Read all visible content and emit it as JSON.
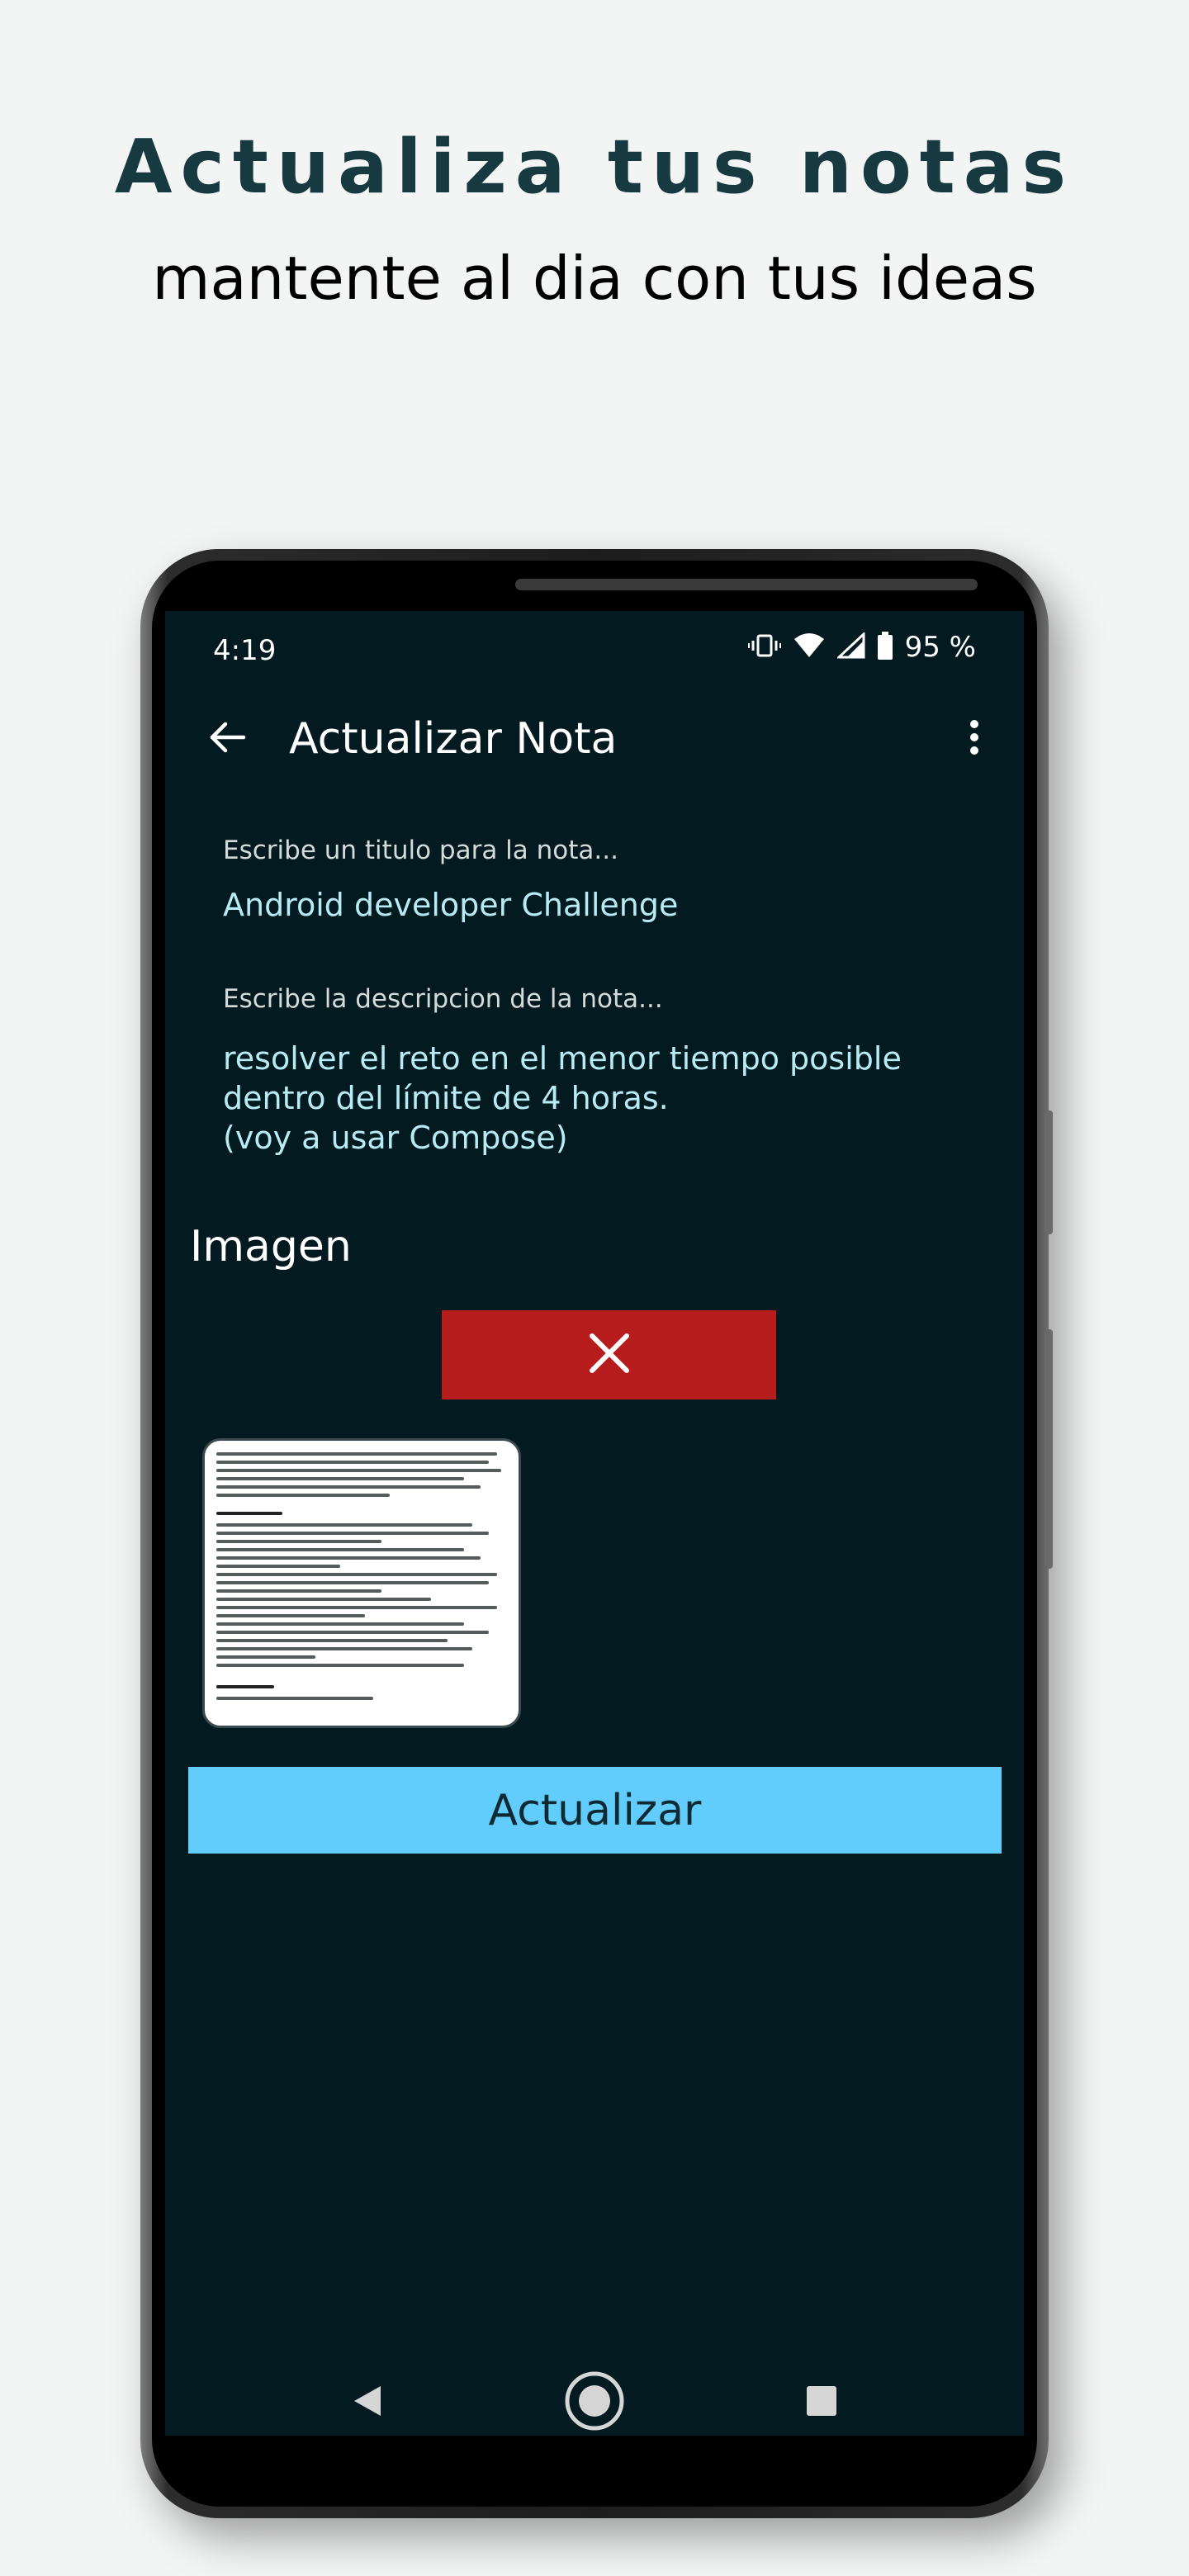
{
  "promo": {
    "headline": "Actualiza tus notas",
    "subheadline": "mantente al dia con tus ideas"
  },
  "status_bar": {
    "time": "4:19",
    "battery": "95 %"
  },
  "app_bar": {
    "title": "Actualizar Nota"
  },
  "form": {
    "title_label": "Escribe un titulo para la nota...",
    "title_value": "Android developer Challenge",
    "description_label": "Escribe la descripcion de la nota...",
    "description_value": "resolver el reto en el menor tiempo posible\ndentro del límite de 4 horas.\n(voy a usar Compose)"
  },
  "image_section": {
    "title": "Imagen"
  },
  "actions": {
    "update_label": "Actualizar"
  },
  "colors": {
    "screen_bg": "#021a20",
    "accent": "#62cdfc",
    "remove": "#b71c1c",
    "field_text": "#b8ecf4"
  },
  "icons": [
    "vibrate-icon",
    "wifi-icon",
    "signal-icon",
    "battery-icon",
    "back-arrow-icon",
    "more-vert-icon",
    "close-icon",
    "nav-back-icon",
    "nav-home-icon",
    "nav-recents-icon"
  ]
}
